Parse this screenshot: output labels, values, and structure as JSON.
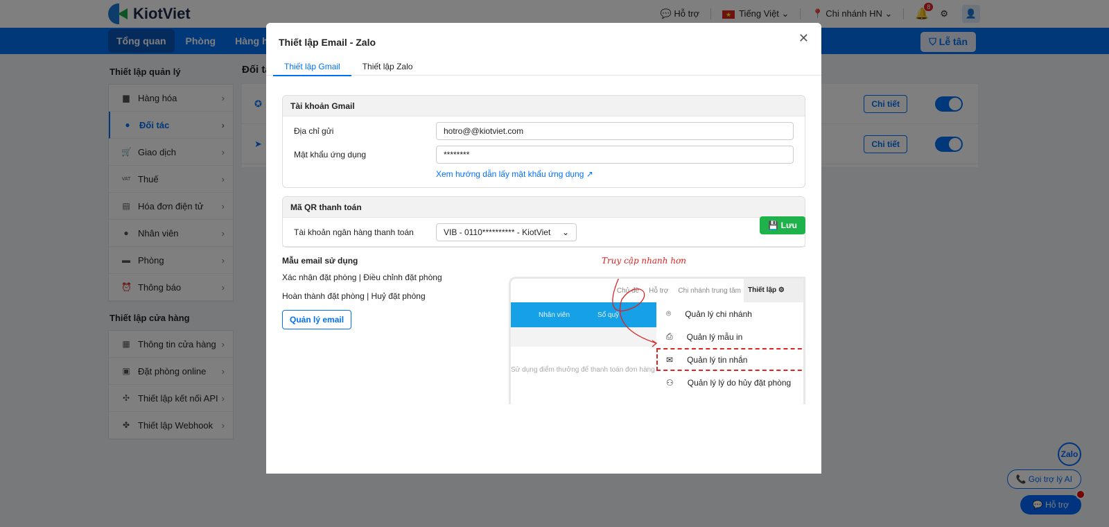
{
  "app": {
    "brand": "KiotViet",
    "support": "Hỗ trợ",
    "language": "Tiếng Việt",
    "branch": "Chi nhánh HN",
    "notifications": "8",
    "reception": "Lễ tân"
  },
  "nav": [
    "Tổng quan",
    "Phòng",
    "Hàng hóa"
  ],
  "sidebar": {
    "group1_title": "Thiết lập quản lý",
    "group1": [
      {
        "label": "Hàng hóa",
        "icon": "box-icon"
      },
      {
        "label": "Đối tác",
        "icon": "user-icon"
      },
      {
        "label": "Giao dịch",
        "icon": "cart-icon"
      },
      {
        "label": "Thuế",
        "icon": "vat-icon"
      },
      {
        "label": "Hóa đơn điện tử",
        "icon": "invoice-icon"
      },
      {
        "label": "Nhân viên",
        "icon": "staff-icon"
      },
      {
        "label": "Phòng",
        "icon": "bed-icon"
      },
      {
        "label": "Thông báo",
        "icon": "alarm-icon"
      }
    ],
    "group2_title": "Thiết lập cửa hàng",
    "group2": [
      {
        "label": "Thông tin cửa hàng",
        "icon": "store-icon"
      },
      {
        "label": "Đặt phòng online",
        "icon": "calendar-icon"
      },
      {
        "label": "Thiết lập kết nối API",
        "icon": "api-icon"
      },
      {
        "label": "Thiết lập Webhook",
        "icon": "webhook-icon"
      }
    ]
  },
  "main": {
    "title": "Đối tác",
    "detail_label": "Chi tiết"
  },
  "floating": {
    "zalo": "Zalo",
    "ai": "Gọi trợ lý AI",
    "support": "Hỗ trợ"
  },
  "modal": {
    "title": "Thiết lập Email - Zalo",
    "tabs": [
      "Thiết lập Gmail",
      "Thiết lập Zalo"
    ],
    "gmail": {
      "title": "Tài khoản Gmail",
      "sender_label": "Địa chỉ gửi",
      "sender_value": "hotro@@kiotviet.com",
      "password_label": "Mật khẩu ứng dụng",
      "password_value": "********",
      "guide_link": "Xem hướng dẫn lấy mật khẩu ứng dụng"
    },
    "qr": {
      "title": "Mã QR thanh toán",
      "bank_label": "Tài khoản ngân hàng thanh toán",
      "bank_value": "VIB - 0110********** - KiotViet"
    },
    "save": "Lưu",
    "templates": {
      "title": "Mẫu email sử dụng",
      "line1": "Xác nhận đặt phòng | Điều chỉnh đặt phòng",
      "line2": "Hoàn thành đặt phòng | Huỷ đặt phòng",
      "manage": "Quản lý email"
    },
    "illustration": {
      "annotation": "Truy cập nhanh hơn",
      "topbar": [
        "Chủ đề",
        "Hỗ trợ",
        "Chi nhánh trung tâm"
      ],
      "settings": "Thiết lập",
      "bluebar": [
        "Nhân viên",
        "Sổ quỹ"
      ],
      "faded_text": "Sử dụng điểm thưởng để thanh toán đơn hàng hoặc",
      "menu": [
        "Quản lý chi nhánh",
        "Quản lý mẫu in",
        "Quản lý tin nhắn",
        "Quản lý lý do hủy đặt phòng"
      ]
    }
  }
}
